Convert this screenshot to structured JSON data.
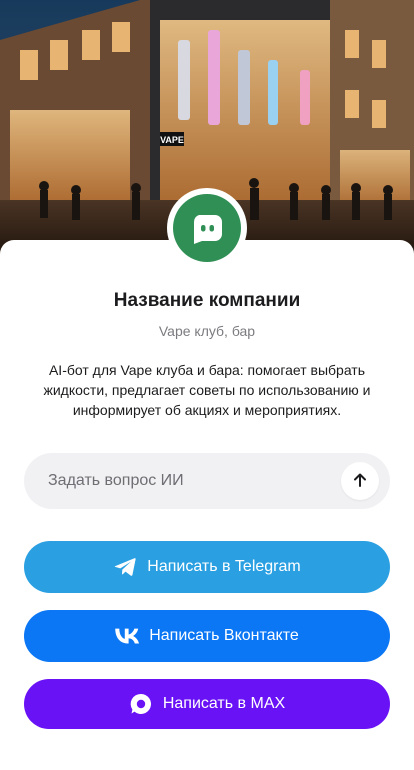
{
  "hero": {
    "storefront_sign": "VAPE"
  },
  "profile": {
    "company_name": "Название компании",
    "category": "Vape клуб, бар",
    "description": "AI-бот для Vape клуба и бара: помогает выбрать жидкости, предлагает советы по использованию и информирует об акциях и мероприятиях."
  },
  "ask": {
    "placeholder": "Задать вопрос ИИ",
    "send_icon": "arrow-up-icon"
  },
  "actions": {
    "telegram": {
      "label": "Написать в Telegram",
      "icon": "telegram-icon",
      "color": "#2aa0e2"
    },
    "vk": {
      "label": "Написать Вконтакте",
      "icon": "vk-icon",
      "color": "#0b77f5"
    },
    "max": {
      "label": "Написать в MAX",
      "icon": "max-icon",
      "color": "#6a12f6"
    }
  },
  "colors": {
    "avatar": "#2f8f55",
    "ask_bg": "#f1f1f3"
  }
}
